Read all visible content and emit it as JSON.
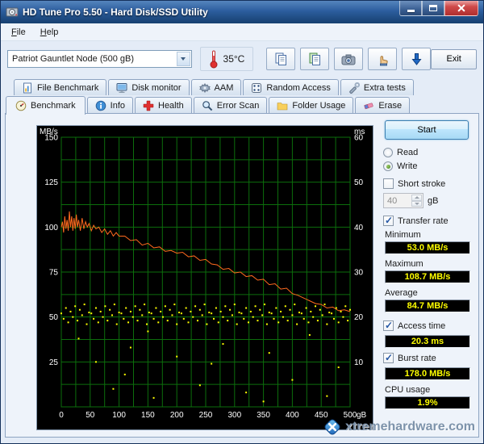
{
  "window": {
    "title": "HD Tune Pro 5.50 - Hard Disk/SSD Utility"
  },
  "menu": {
    "items": [
      "File",
      "Help"
    ]
  },
  "toolbar": {
    "drive_select": "Patriot Gauntlet Node (500 gB)",
    "temperature": "35°C",
    "exit_label": "Exit"
  },
  "tabs": {
    "row1": [
      "File Benchmark",
      "Disk monitor",
      "AAM",
      "Random Access",
      "Extra tests"
    ],
    "row2": [
      "Benchmark",
      "Info",
      "Health",
      "Error Scan",
      "Folder Usage",
      "Erase"
    ],
    "active": "Benchmark"
  },
  "controls": {
    "start_label": "Start",
    "read_label": "Read",
    "write_label": "Write",
    "short_stroke_label": "Short stroke",
    "short_stroke_value": "40",
    "short_stroke_unit": "gB",
    "transfer_rate_label": "Transfer rate",
    "minimum_label": "Minimum",
    "minimum_value": "53.0 MB/s",
    "maximum_label": "Maximum",
    "maximum_value": "108.7 MB/s",
    "average_label": "Average",
    "average_value": "84.7 MB/s",
    "access_time_label": "Access time",
    "access_time_value": "20.3 ms",
    "burst_rate_label": "Burst rate",
    "burst_rate_value": "178.0 MB/s",
    "cpu_usage_label": "CPU usage",
    "cpu_usage_value": "1.9%"
  },
  "watermark": "xtremehardware.com",
  "colors": {
    "value_text": "#ffff00",
    "chart_bg": "#000000"
  },
  "chart_data": {
    "type": "line",
    "title": "HD Tune write benchmark",
    "x_range": [
      0,
      500
    ],
    "x_ticks": [
      0,
      50,
      100,
      150,
      200,
      250,
      300,
      350,
      400,
      450,
      500
    ],
    "x_unit": "gB",
    "y_left_unit": "MB/s",
    "y_left_range": [
      0,
      150
    ],
    "y_left_ticks": [
      150,
      125,
      100,
      75,
      50,
      25
    ],
    "y_right_unit": "ms",
    "y_right_range": [
      0,
      60
    ],
    "y_right_ticks": [
      60,
      50,
      40,
      30,
      20,
      10
    ],
    "grid_color": "#0c6e0c",
    "grid_step_x": 25,
    "grid_step_y_left": 12.5,
    "stats": {
      "minimum_mbps": 53.0,
      "maximum_mbps": 108.7,
      "average_mbps": 84.7,
      "access_time_ms": 20.3,
      "burst_rate_mbps": 178.0,
      "cpu_usage_pct": 1.9
    },
    "series": [
      {
        "name": "Transfer rate",
        "axis": "left",
        "style": "line",
        "color": "#ff6a1e",
        "unit": "MB/s",
        "points": [
          [
            0,
            100
          ],
          [
            2,
            103
          ],
          [
            4,
            97
          ],
          [
            6,
            106
          ],
          [
            8,
            99
          ],
          [
            10,
            104
          ],
          [
            12,
            98
          ],
          [
            14,
            108.7
          ],
          [
            16,
            100
          ],
          [
            18,
            106
          ],
          [
            20,
            98
          ],
          [
            22,
            105
          ],
          [
            24,
            99
          ],
          [
            26,
            107
          ],
          [
            28,
            100
          ],
          [
            30,
            104
          ],
          [
            33,
            98
          ],
          [
            36,
            105
          ],
          [
            39,
            99
          ],
          [
            42,
            103
          ],
          [
            45,
            100
          ],
          [
            48,
            102
          ],
          [
            52,
            98
          ],
          [
            56,
            101
          ],
          [
            60,
            99
          ],
          [
            65,
            100
          ],
          [
            70,
            97
          ],
          [
            75,
            99
          ],
          [
            80,
            96
          ],
          [
            85,
            98
          ],
          [
            90,
            95
          ],
          [
            95,
            97
          ],
          [
            100,
            95
          ],
          [
            110,
            95
          ],
          [
            120,
            92.5
          ],
          [
            130,
            93
          ],
          [
            140,
            90
          ],
          [
            150,
            91
          ],
          [
            160,
            88.5
          ],
          [
            170,
            89
          ],
          [
            180,
            86.5
          ],
          [
            190,
            87
          ],
          [
            200,
            85.5
          ],
          [
            210,
            86
          ],
          [
            220,
            83.5
          ],
          [
            230,
            84
          ],
          [
            240,
            81.5
          ],
          [
            250,
            82
          ],
          [
            260,
            79.5
          ],
          [
            270,
            79
          ],
          [
            280,
            76.5
          ],
          [
            290,
            77
          ],
          [
            300,
            74.5
          ],
          [
            310,
            75
          ],
          [
            320,
            72.5
          ],
          [
            330,
            73
          ],
          [
            340,
            70.5
          ],
          [
            350,
            71
          ],
          [
            360,
            68
          ],
          [
            370,
            68.5
          ],
          [
            380,
            65.5
          ],
          [
            390,
            66
          ],
          [
            400,
            63
          ],
          [
            410,
            62
          ],
          [
            420,
            60.5
          ],
          [
            430,
            59
          ],
          [
            440,
            57.5
          ],
          [
            450,
            57
          ],
          [
            460,
            55
          ],
          [
            470,
            55.5
          ],
          [
            480,
            53.5
          ],
          [
            490,
            54
          ],
          [
            500,
            53
          ]
        ]
      },
      {
        "name": "Access time",
        "axis": "right",
        "style": "dots",
        "color": "#ffff00",
        "unit": "ms",
        "points": [
          [
            0,
            20.8
          ],
          [
            4,
            19.6
          ],
          [
            8,
            22.0
          ],
          [
            12,
            18.8
          ],
          [
            16,
            21.2
          ],
          [
            20,
            20.0
          ],
          [
            24,
            22.4
          ],
          [
            28,
            19.2
          ],
          [
            32,
            21.6
          ],
          [
            36,
            20.4
          ],
          [
            40,
            22.8
          ],
          [
            44,
            18.4
          ],
          [
            48,
            21.0
          ],
          [
            52,
            20.8
          ],
          [
            56,
            19.6
          ],
          [
            60,
            22.0
          ],
          [
            64,
            18.8
          ],
          [
            68,
            21.2
          ],
          [
            72,
            20.0
          ],
          [
            76,
            22.4
          ],
          [
            80,
            19.2
          ],
          [
            84,
            21.6
          ],
          [
            88,
            20.4
          ],
          [
            92,
            22.8
          ],
          [
            96,
            18.4
          ],
          [
            100,
            21.0
          ],
          [
            104,
            20.8
          ],
          [
            108,
            19.6
          ],
          [
            112,
            22.0
          ],
          [
            116,
            18.8
          ],
          [
            120,
            21.2
          ],
          [
            124,
            20.0
          ],
          [
            128,
            22.4
          ],
          [
            132,
            19.2
          ],
          [
            136,
            21.6
          ],
          [
            140,
            20.4
          ],
          [
            144,
            22.8
          ],
          [
            148,
            18.4
          ],
          [
            152,
            21.0
          ],
          [
            156,
            20.8
          ],
          [
            160,
            19.6
          ],
          [
            164,
            22.0
          ],
          [
            168,
            18.8
          ],
          [
            172,
            21.2
          ],
          [
            176,
            20.0
          ],
          [
            180,
            22.4
          ],
          [
            184,
            19.2
          ],
          [
            188,
            21.6
          ],
          [
            192,
            20.4
          ],
          [
            196,
            22.8
          ],
          [
            200,
            18.4
          ],
          [
            204,
            21.0
          ],
          [
            208,
            20.8
          ],
          [
            212,
            19.6
          ],
          [
            216,
            22.0
          ],
          [
            220,
            18.8
          ],
          [
            224,
            21.2
          ],
          [
            228,
            20.0
          ],
          [
            232,
            22.4
          ],
          [
            236,
            19.2
          ],
          [
            240,
            21.6
          ],
          [
            244,
            20.4
          ],
          [
            248,
            22.8
          ],
          [
            252,
            18.4
          ],
          [
            256,
            21.0
          ],
          [
            260,
            20.8
          ],
          [
            264,
            19.6
          ],
          [
            268,
            22.0
          ],
          [
            272,
            18.8
          ],
          [
            276,
            21.2
          ],
          [
            280,
            20.0
          ],
          [
            284,
            22.4
          ],
          [
            288,
            19.2
          ],
          [
            292,
            21.6
          ],
          [
            296,
            20.4
          ],
          [
            300,
            22.8
          ],
          [
            304,
            18.4
          ],
          [
            308,
            21.0
          ],
          [
            312,
            20.8
          ],
          [
            316,
            19.6
          ],
          [
            320,
            22.0
          ],
          [
            324,
            18.8
          ],
          [
            328,
            21.2
          ],
          [
            332,
            20.0
          ],
          [
            336,
            22.4
          ],
          [
            340,
            19.2
          ],
          [
            344,
            21.6
          ],
          [
            348,
            20.4
          ],
          [
            352,
            22.8
          ],
          [
            356,
            18.4
          ],
          [
            360,
            21.0
          ],
          [
            364,
            20.8
          ],
          [
            368,
            19.6
          ],
          [
            372,
            22.0
          ],
          [
            376,
            18.8
          ],
          [
            380,
            21.2
          ],
          [
            384,
            20.0
          ],
          [
            388,
            22.4
          ],
          [
            392,
            19.2
          ],
          [
            396,
            21.6
          ],
          [
            400,
            20.4
          ],
          [
            404,
            22.8
          ],
          [
            408,
            18.4
          ],
          [
            412,
            21.0
          ],
          [
            416,
            20.8
          ],
          [
            420,
            19.6
          ],
          [
            424,
            22.0
          ],
          [
            428,
            18.8
          ],
          [
            432,
            21.2
          ],
          [
            436,
            20.0
          ],
          [
            440,
            22.4
          ],
          [
            444,
            19.2
          ],
          [
            448,
            21.6
          ],
          [
            452,
            20.4
          ],
          [
            456,
            22.8
          ],
          [
            460,
            18.4
          ],
          [
            464,
            21.0
          ],
          [
            468,
            20.8
          ],
          [
            472,
            19.6
          ],
          [
            476,
            22.0
          ],
          [
            480,
            18.8
          ],
          [
            484,
            21.2
          ],
          [
            488,
            20.0
          ],
          [
            492,
            22.4
          ],
          [
            496,
            19.2
          ],
          [
            500,
            21.6
          ],
          [
            30,
            15.2
          ],
          [
            60,
            10.0
          ],
          [
            90,
            4.0
          ],
          [
            110,
            7.2
          ],
          [
            120,
            13.2
          ],
          [
            150,
            16.8
          ],
          [
            160,
            2.0
          ],
          [
            200,
            11.2
          ],
          [
            240,
            4.8
          ],
          [
            260,
            9.6
          ],
          [
            280,
            14.0
          ],
          [
            320,
            3.2
          ],
          [
            350,
            1.2
          ],
          [
            360,
            12.0
          ],
          [
            400,
            6.0
          ],
          [
            430,
            16.0
          ],
          [
            460,
            2.4
          ],
          [
            480,
            8.8
          ]
        ]
      }
    ]
  }
}
